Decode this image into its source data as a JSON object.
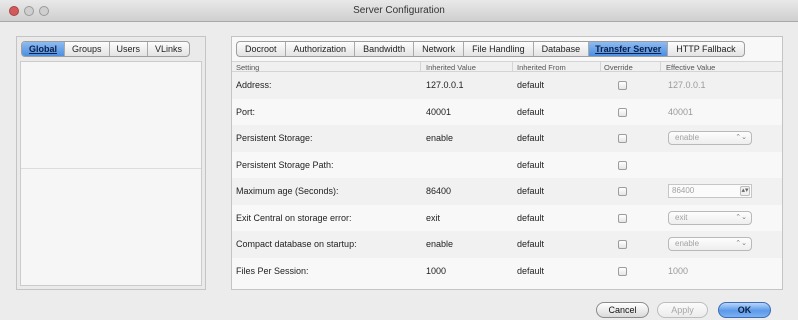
{
  "window": {
    "title": "Server Configuration"
  },
  "left_pane": {
    "tabs": [
      {
        "label": "Global",
        "active": true
      },
      {
        "label": "Groups",
        "active": false
      },
      {
        "label": "Users",
        "active": false
      },
      {
        "label": "VLinks",
        "active": false
      }
    ]
  },
  "right_pane": {
    "tabs": [
      {
        "label": "Docroot",
        "active": false
      },
      {
        "label": "Authorization",
        "active": false
      },
      {
        "label": "Bandwidth",
        "active": false
      },
      {
        "label": "Network",
        "active": false
      },
      {
        "label": "File Handling",
        "active": false
      },
      {
        "label": "Database",
        "active": false
      },
      {
        "label": "Transfer Server",
        "active": true
      },
      {
        "label": "HTTP Fallback",
        "active": false
      }
    ],
    "table": {
      "columns": [
        "Setting",
        "Inherited Value",
        "Inherited From",
        "Override",
        "Effective Value"
      ],
      "rows": [
        {
          "setting": "Address:",
          "inherited_value": "127.0.0.1",
          "inherited_from": "default",
          "override": false,
          "effective_value": "127.0.0.1",
          "effective_type": "text"
        },
        {
          "setting": "Port:",
          "inherited_value": "40001",
          "inherited_from": "default",
          "override": false,
          "effective_value": "40001",
          "effective_type": "text"
        },
        {
          "setting": "Persistent Storage:",
          "inherited_value": "enable",
          "inherited_from": "default",
          "override": false,
          "effective_value": "enable",
          "effective_type": "popup"
        },
        {
          "setting": "Persistent Storage Path:",
          "inherited_value": "",
          "inherited_from": "default",
          "override": false,
          "effective_value": "",
          "effective_type": "none"
        },
        {
          "setting": "Maximum age (Seconds):",
          "inherited_value": "86400",
          "inherited_from": "default",
          "override": false,
          "effective_value": "86400",
          "effective_type": "stepper"
        },
        {
          "setting": "Exit Central on storage error:",
          "inherited_value": "exit",
          "inherited_from": "default",
          "override": false,
          "effective_value": "exit",
          "effective_type": "popup"
        },
        {
          "setting": "Compact database on startup:",
          "inherited_value": "enable",
          "inherited_from": "default",
          "override": false,
          "effective_value": "enable",
          "effective_type": "popup"
        },
        {
          "setting": "Files Per Session:",
          "inherited_value": "1000",
          "inherited_from": "default",
          "override": false,
          "effective_value": "1000",
          "effective_type": "text"
        }
      ]
    }
  },
  "buttons": {
    "cancel": "Cancel",
    "apply": "Apply",
    "ok": "OK"
  },
  "glyphs": {
    "popup_arrows": "⌃⌄",
    "stepper_arrows": "▴▾"
  },
  "colors": {
    "active_tab": "#4c8fe0",
    "close_button": "#d35a5a",
    "default_button": "#5b9ae8"
  }
}
